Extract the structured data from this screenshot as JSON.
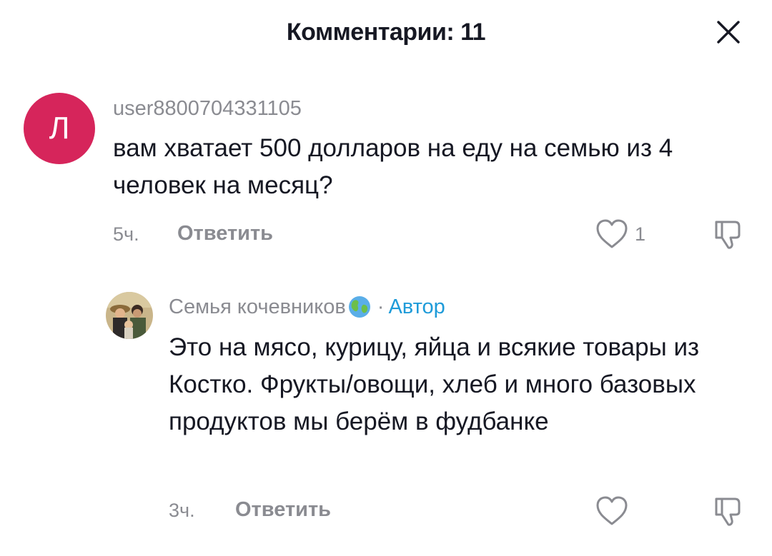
{
  "header": {
    "title": "Комментарии: 11"
  },
  "comments": [
    {
      "avatar_letter": "Л",
      "avatar_color": "#d6255b",
      "username": "user8800704331105",
      "text": "вам хватает 500 долларов на еду на семью из 4 человек на месяц?",
      "time": "5ч.",
      "reply_label": "Ответить",
      "likes": "1"
    }
  ],
  "replies": [
    {
      "username": "Семья кочевников",
      "username_icon": "globe-icon",
      "separator": "·",
      "author_tag": "Автор",
      "author_color": "#1e9bd9",
      "text": "Это на мясо, курицу, яйца и всякие товары из Костко. Фрукты/овощи, хлеб и много базовых продуктов мы берём в фудбанке",
      "time": "3ч.",
      "reply_label": "Ответить"
    }
  ],
  "colors": {
    "muted": "#8a8b91",
    "text": "#161823"
  }
}
